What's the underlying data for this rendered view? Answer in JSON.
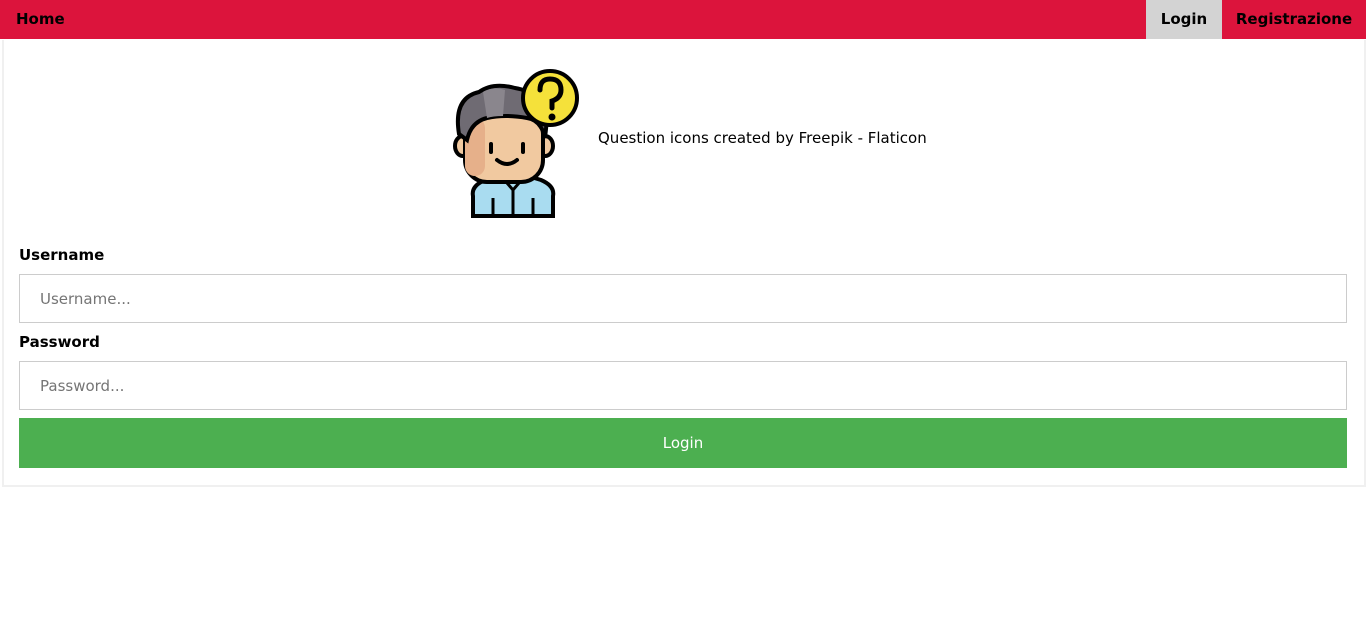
{
  "nav": {
    "home_label": "Home",
    "login_label": "Login",
    "register_label": "Registrazione",
    "bar_color": "#dc143c",
    "active_color": "#d3d3d3"
  },
  "hero": {
    "icon": "person-question-icon",
    "credit_text": "Question icons created by Freepik - Flaticon"
  },
  "form": {
    "username_label": "Username",
    "username_placeholder": "Username...",
    "username_value": "",
    "password_label": "Password",
    "password_placeholder": "Password...",
    "password_value": "",
    "submit_label": "Login",
    "submit_color": "#4caf50"
  }
}
